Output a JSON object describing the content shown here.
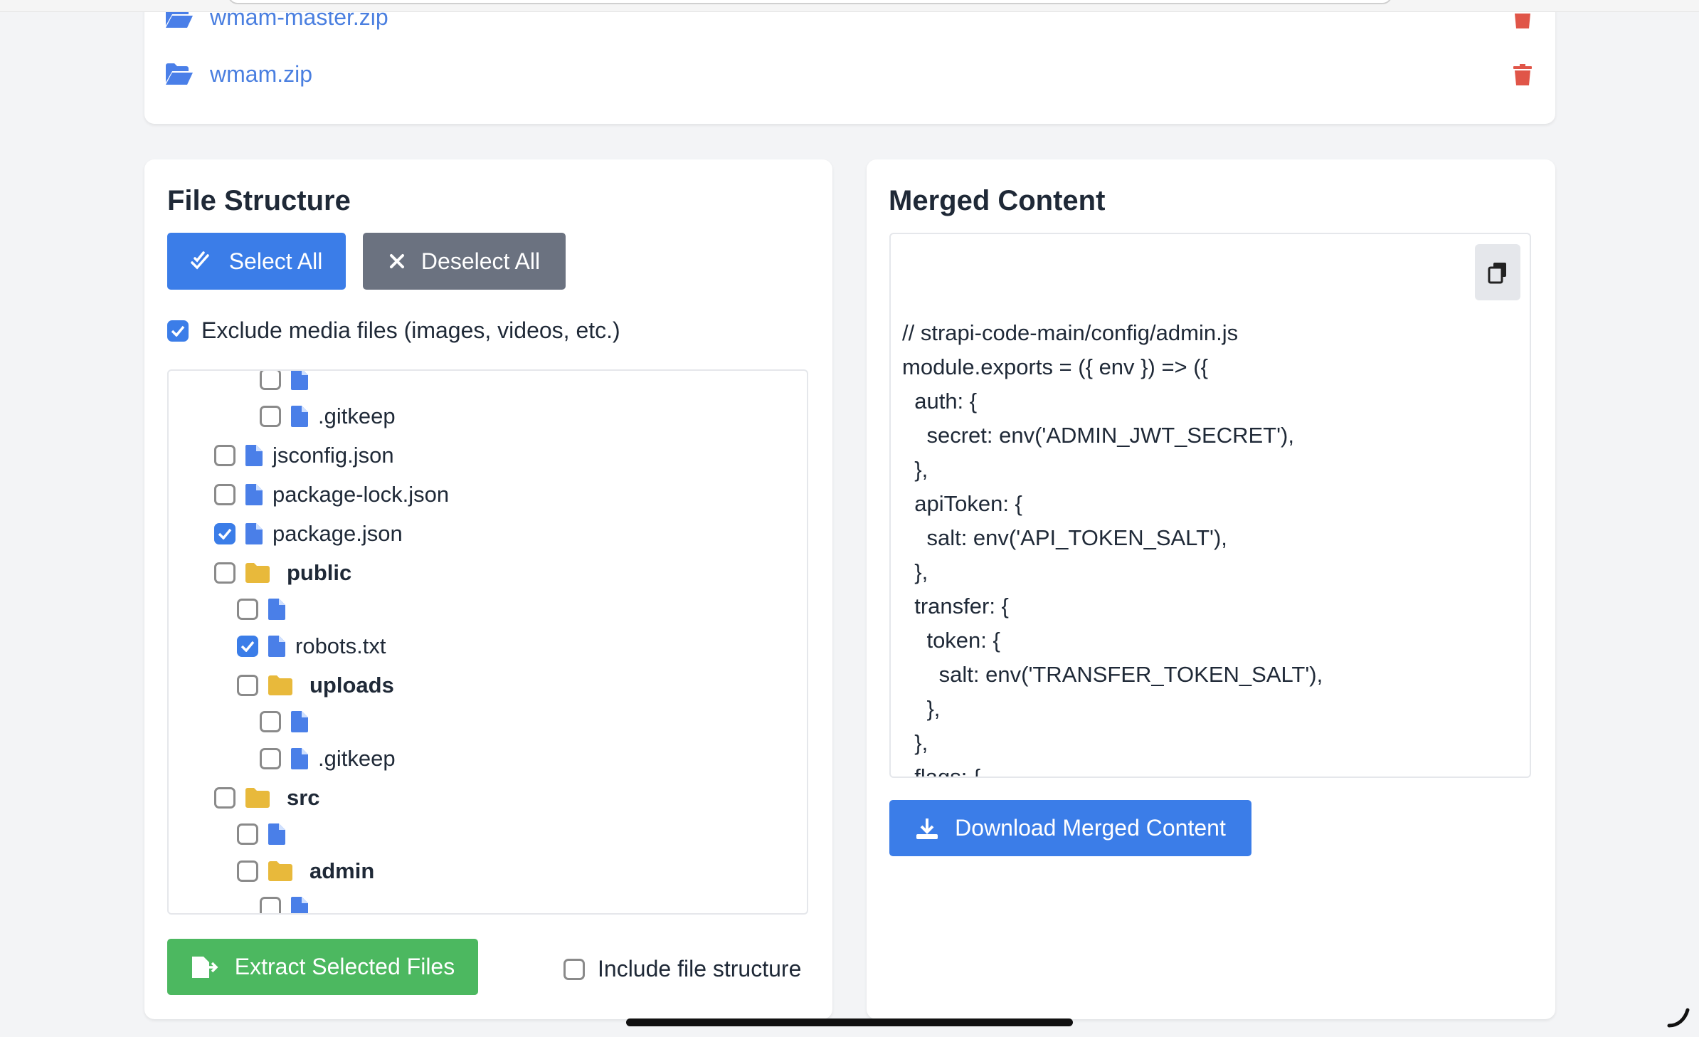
{
  "uploaded_files": [
    {
      "name": "wmam-master.zip"
    },
    {
      "name": "wmam.zip"
    }
  ],
  "file_structure": {
    "title": "File Structure",
    "select_all": "Select All",
    "deselect_all": "Deselect All",
    "exclude_media": {
      "label": "Exclude media files (images, videos, etc.)",
      "checked": true
    },
    "tree": [
      {
        "name": "",
        "type": "file",
        "level": 2,
        "checked": false
      },
      {
        "name": ".gitkeep",
        "type": "file",
        "level": 2,
        "checked": false
      },
      {
        "name": "jsconfig.json",
        "type": "file",
        "level": 0,
        "checked": false
      },
      {
        "name": "package-lock.json",
        "type": "file",
        "level": 0,
        "checked": false
      },
      {
        "name": "package.json",
        "type": "file",
        "level": 0,
        "checked": true
      },
      {
        "name": "public",
        "type": "folder",
        "level": 0,
        "checked": false
      },
      {
        "name": "",
        "type": "file",
        "level": 1,
        "checked": false
      },
      {
        "name": "robots.txt",
        "type": "file",
        "level": 1,
        "checked": true
      },
      {
        "name": "uploads",
        "type": "folder",
        "level": 1,
        "checked": false
      },
      {
        "name": "",
        "type": "file",
        "level": 2,
        "checked": false
      },
      {
        "name": ".gitkeep",
        "type": "file",
        "level": 2,
        "checked": false
      },
      {
        "name": "src",
        "type": "folder",
        "level": 0,
        "checked": false
      },
      {
        "name": "",
        "type": "file",
        "level": 1,
        "checked": false
      },
      {
        "name": "admin",
        "type": "folder",
        "level": 1,
        "checked": false
      },
      {
        "name": "",
        "type": "file",
        "level": 2,
        "checked": false
      },
      {
        "name": "",
        "type": "file",
        "level": 2,
        "checked": false
      }
    ],
    "extract_button": "Extract Selected Files",
    "include_structure": {
      "label": "Include file structure",
      "checked": false
    }
  },
  "merged_content": {
    "title": "Merged Content",
    "code": "// strapi-code-main/config/admin.js\nmodule.exports = ({ env }) => ({\n  auth: {\n    secret: env('ADMIN_JWT_SECRET'),\n  },\n  apiToken: {\n    salt: env('API_TOKEN_SALT'),\n  },\n  transfer: {\n    token: {\n      salt: env('TRANSFER_TOKEN_SALT'),\n    },\n  },\n  flags: {",
    "download_button": "Download Merged Content"
  },
  "colors": {
    "primary": "#3b7de8",
    "secondary": "#6b7280",
    "success": "#4cb860",
    "danger": "#e05548",
    "folder": "#e8b93b",
    "link": "#4a7fe0"
  },
  "icons": {
    "zip": "folder-open-icon",
    "delete": "trash-icon",
    "select": "double-check-icon",
    "deselect": "x-icon",
    "copy": "copy-icon",
    "download": "download-icon",
    "extract": "file-export-icon"
  }
}
